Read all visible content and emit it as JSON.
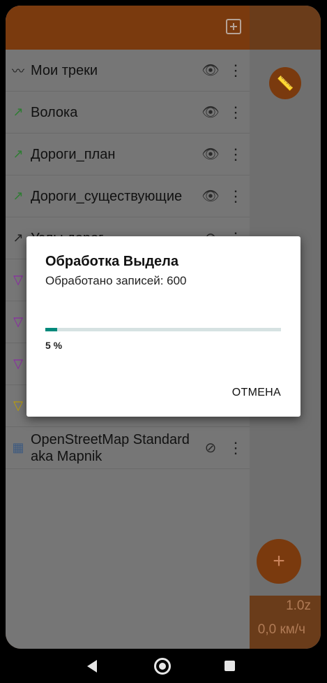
{
  "map": {
    "zoom": "1.0z",
    "speed": "0,0 км/ч"
  },
  "drawer": {
    "header": {
      "add_layer_icon": "layers-add-icon"
    },
    "layers": [
      {
        "name": "Мои треки",
        "icon": "track-icon",
        "visible": true
      },
      {
        "name": "Волока",
        "icon": "track-sync-icon",
        "visible": true
      },
      {
        "name": "Дороги_план",
        "icon": "track-sync-icon",
        "visible": true
      },
      {
        "name": "Дороги_существующие",
        "icon": "track-sync-icon",
        "visible": true
      },
      {
        "name": "Узлы дорог",
        "icon": "track-sync-icon",
        "visible": false
      },
      {
        "name": "",
        "icon": "poly-icon",
        "visible": true
      },
      {
        "name": "",
        "icon": "poly-icon",
        "visible": true
      },
      {
        "name": "",
        "icon": "poly-icon",
        "visible": true
      },
      {
        "name": "",
        "icon": "poly-icon-yellow",
        "visible": true
      },
      {
        "name": "OpenStreetMap Standard aka Mapnik",
        "icon": "map-tile-icon",
        "visible": false
      }
    ]
  },
  "dialog": {
    "title": "Обработка Выдела",
    "message": "Обработано записей: 600",
    "progress": 0.05,
    "percent_label": "5 %",
    "cancel_label": "ОТМЕНА"
  },
  "colors": {
    "accent": "#00897b",
    "brand": "#7a3a0e"
  }
}
